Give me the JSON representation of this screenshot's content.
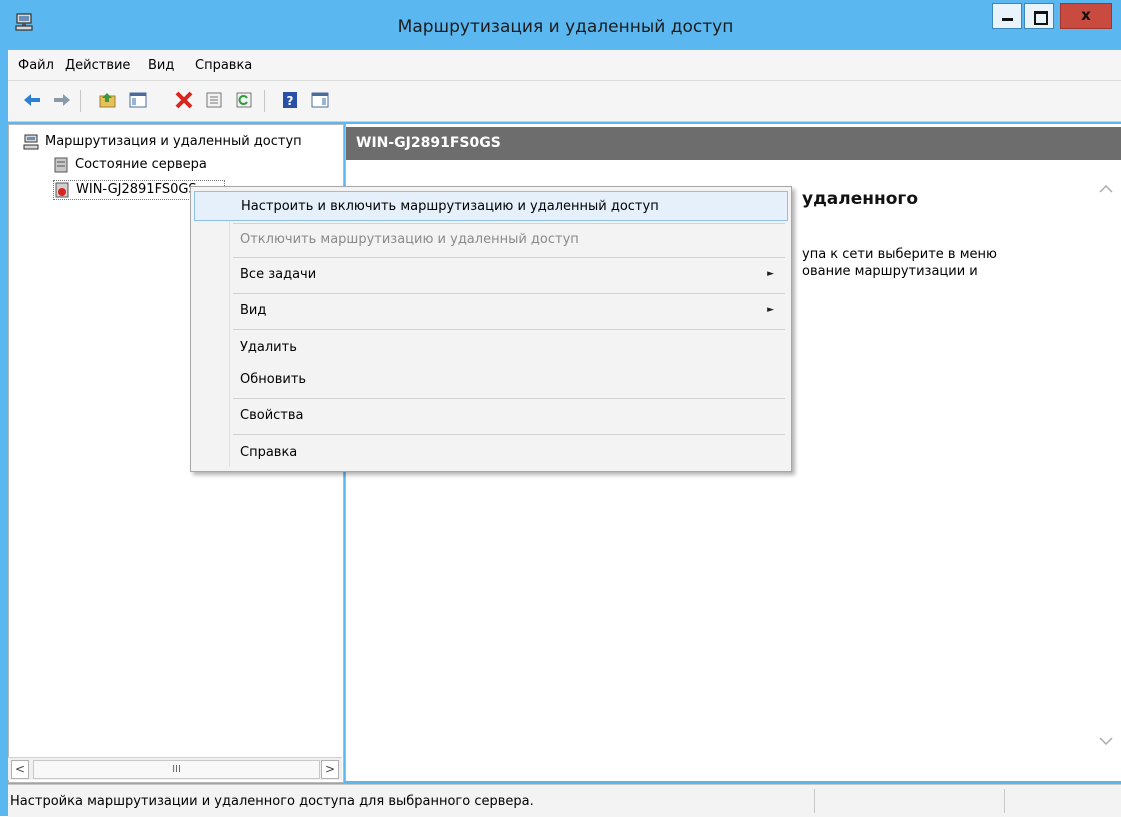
{
  "window": {
    "title": "Маршрутизация и удаленный доступ",
    "close_glyph": "x"
  },
  "menubar": {
    "items": [
      "Файл",
      "Действие",
      "Вид",
      "Справка"
    ]
  },
  "toolbar": {
    "icons": [
      "back-icon",
      "forward-icon",
      "up-folder-icon",
      "show-hide-tree-icon",
      "delete-icon",
      "properties-icon",
      "refresh-icon",
      "help-icon",
      "show-hide-action-pane-icon"
    ]
  },
  "tree": {
    "root_label": "Маршрутизация и удаленный доступ",
    "server_status_label": "Состояние сервера",
    "server_label": "WIN-GJ2891FS0GS"
  },
  "hscroll": {
    "left_glyph": "<",
    "thumb_glyph": "III",
    "right_glyph": ">"
  },
  "right_pane": {
    "header": "WIN-GJ2891FS0GS",
    "heading_fragment": "удаленного",
    "text_line_1": "упа к сети выберите в меню",
    "text_line_2": "ование маршрутизации и"
  },
  "context_menu": {
    "items": [
      {
        "label": "Настроить и включить маршрутизацию и удаленный доступ",
        "highlighted": true
      },
      {
        "label": "Отключить маршрутизацию и удаленный доступ",
        "disabled": true
      },
      {
        "label": "Все задачи",
        "submenu": true
      },
      {
        "label": "Вид",
        "submenu": true
      },
      {
        "label": "Удалить"
      },
      {
        "label": "Обновить"
      },
      {
        "label": "Свойства"
      },
      {
        "label": "Справка"
      }
    ],
    "submenu_glyph": "►"
  },
  "status_bar": {
    "text": "Настройка маршрутизации и удаленного доступа для выбранного сервера."
  },
  "colors": {
    "title_bar": "#5ab7f0",
    "close_button": "#c94b3f",
    "header_bar": "#6d6d6d",
    "menu_highlight": "#e5f0fb"
  }
}
